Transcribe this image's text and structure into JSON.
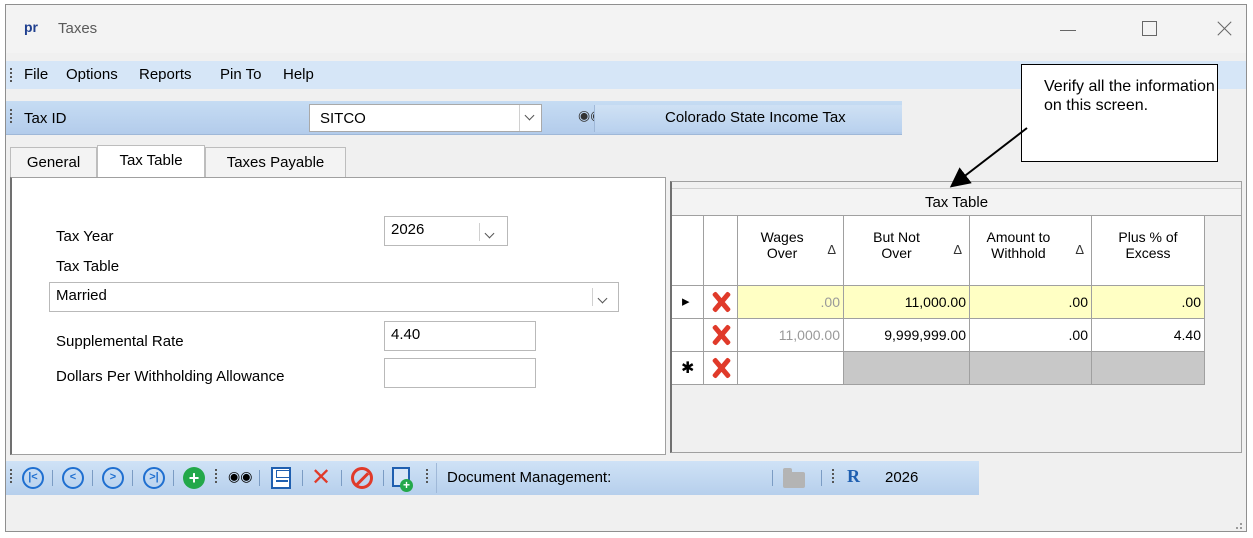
{
  "window": {
    "logo": "pr",
    "title": "Taxes"
  },
  "menu": {
    "items": [
      "File",
      "Options",
      "Reports",
      "Pin To",
      "Help"
    ]
  },
  "taxid": {
    "label": "Tax ID",
    "value": "SITCO",
    "description": "Colorado State Income Tax"
  },
  "tabs": [
    {
      "label": "General",
      "active": false
    },
    {
      "label": "Tax Table",
      "active": true
    },
    {
      "label": "Taxes Payable",
      "active": false
    }
  ],
  "form": {
    "tax_year_label": "Tax Year",
    "tax_year_value": "2026",
    "tax_table_label": "Tax Table",
    "tax_table_value": "Married",
    "supplemental_label": "Supplemental Rate",
    "supplemental_value": "4.40",
    "dollars_label": "Dollars Per Withholding Allowance",
    "dollars_value": ""
  },
  "grid": {
    "caption": "Tax Table",
    "sort_glyph": "Δ",
    "columns": [
      {
        "line1": "Wages",
        "line2": "Over",
        "sortable": true
      },
      {
        "line1": "But Not",
        "line2": "Over",
        "sortable": true
      },
      {
        "line1": "Amount to",
        "line2": "Withhold",
        "sortable": true
      },
      {
        "line1": "Plus % of",
        "line2": "Excess",
        "sortable": false
      }
    ],
    "rows": [
      {
        "marker": "current",
        "wages_over": ".00",
        "but_not_over": "11,000.00",
        "amount_to_withhold": ".00",
        "plus_pct_excess": ".00"
      },
      {
        "marker": "",
        "wages_over": "11,000.00",
        "but_not_over": "9,999,999.00",
        "amount_to_withhold": ".00",
        "plus_pct_excess": "4.40"
      },
      {
        "marker": "new",
        "wages_over": "",
        "but_not_over": "",
        "amount_to_withhold": "",
        "plus_pct_excess": ""
      }
    ],
    "marker_current": "▸",
    "marker_new": "✱"
  },
  "toolbar": {
    "doc_management_label": "Document Management:",
    "year": "2026",
    "icons": [
      "first-record-icon",
      "previous-record-icon",
      "next-record-icon",
      "last-record-icon",
      "add-record-icon",
      "find-icon",
      "save-icon",
      "delete-icon",
      "cancel-icon",
      "save-new-icon",
      "folder-icon",
      "report-icon"
    ]
  },
  "callout": {
    "text": "Verify all the information on this screen."
  },
  "colors": {
    "menu_bg": "#d6e6f7",
    "toolbar_bg": "#c6dcf3",
    "highlight_row": "#ffffc4",
    "delete_red": "#e03a2a"
  }
}
